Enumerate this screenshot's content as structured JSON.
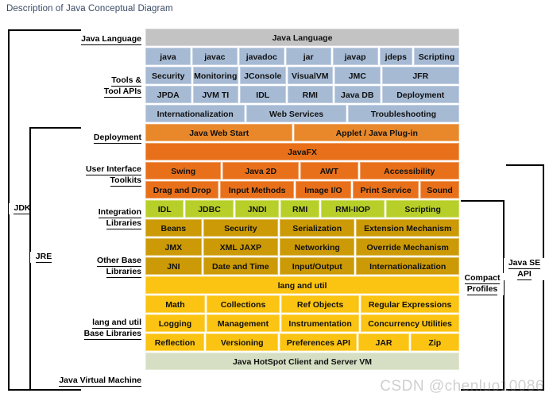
{
  "page": {
    "title": "Description of Java Conceptual Diagram",
    "watermark": "CSDN @chenluo10086"
  },
  "left_labels": {
    "java_language": "Java Language",
    "tools_line1": "Tools &",
    "tools_line2": "Tool APIs",
    "deployment": "Deployment",
    "ui_line1": "User Interface",
    "ui_line2": "Toolkits",
    "integration_line1": "Integration",
    "integration_line2": "Libraries",
    "other_base_line1": "Other Base",
    "other_base_line2": "Libraries",
    "lang_util_line1": "lang and util",
    "lang_util_line2": "Base Libraries",
    "jvm": "Java Virtual Machine"
  },
  "brackets": {
    "jdk": "JDK",
    "jre": "JRE",
    "compact_line1": "Compact",
    "compact_line2": "Profiles",
    "javase_line1": "Java SE",
    "javase_line2": "API"
  },
  "colors": {
    "gray": "#c3c3c3",
    "blue": "#a6bad4",
    "orange": "#e8882b",
    "orange_dark": "#e8701a",
    "green": "#b7cf28",
    "amber_dark": "#cc9a06",
    "amber": "#fbc312",
    "sage": "#d6dfc3"
  },
  "rows": [
    {
      "name": "java-language",
      "theme": "c-gray",
      "cells": [
        {
          "label": "Java Language",
          "flex": 1
        }
      ]
    },
    {
      "name": "tools-row-1",
      "theme": "c-blue",
      "cells": [
        {
          "label": "java",
          "flex": 1
        },
        {
          "label": "javac",
          "flex": 1
        },
        {
          "label": "javadoc",
          "flex": 1
        },
        {
          "label": "jar",
          "flex": 1
        },
        {
          "label": "javap",
          "flex": 1
        },
        {
          "label": "jdeps",
          "flex": 0.72
        },
        {
          "label": "Scripting",
          "flex": 1
        }
      ]
    },
    {
      "name": "tools-row-2",
      "theme": "c-blue",
      "cells": [
        {
          "label": "Security",
          "flex": 1
        },
        {
          "label": "Monitoring",
          "flex": 1
        },
        {
          "label": "JConsole",
          "flex": 1
        },
        {
          "label": "VisualVM",
          "flex": 1
        },
        {
          "label": "JMC",
          "flex": 1
        },
        {
          "label": "JFR",
          "flex": 1.72
        }
      ]
    },
    {
      "name": "tools-row-3",
      "theme": "c-blue",
      "cells": [
        {
          "label": "JPDA",
          "flex": 1
        },
        {
          "label": "JVM TI",
          "flex": 1
        },
        {
          "label": "IDL",
          "flex": 1
        },
        {
          "label": "RMI",
          "flex": 1
        },
        {
          "label": "Java DB",
          "flex": 1
        },
        {
          "label": "Deployment",
          "flex": 1.72
        }
      ]
    },
    {
      "name": "tools-row-4",
      "theme": "c-blue",
      "cells": [
        {
          "label": "Internationalization",
          "flex": 1
        },
        {
          "label": "Web Services",
          "flex": 1
        },
        {
          "label": "Troubleshooting",
          "flex": 1.12
        }
      ]
    },
    {
      "name": "deployment-row",
      "theme": "c-orange",
      "cells": [
        {
          "label": "Java Web Start",
          "flex": 1
        },
        {
          "label": "Applet / Java Plug-in",
          "flex": 1.12
        }
      ]
    },
    {
      "name": "javafx-row",
      "theme": "c-orange2",
      "cells": [
        {
          "label": "JavaFX",
          "flex": 1
        }
      ]
    },
    {
      "name": "ui-toolkits-row-1",
      "theme": "c-orange2",
      "cells": [
        {
          "label": "Swing",
          "flex": 1.06
        },
        {
          "label": "Java 2D",
          "flex": 1.06
        },
        {
          "label": "AWT",
          "flex": 0.8
        },
        {
          "label": "Accessibility",
          "flex": 1.4
        }
      ]
    },
    {
      "name": "ui-toolkits-row-2",
      "theme": "c-orange2",
      "cells": [
        {
          "label": "Drag and Drop",
          "flex": 1.06
        },
        {
          "label": "Input Methods",
          "flex": 1.06
        },
        {
          "label": "Image I/O",
          "flex": 0.8
        },
        {
          "label": "Print Service",
          "flex": 0.95
        },
        {
          "label": "Sound",
          "flex": 0.55
        }
      ]
    },
    {
      "name": "integration-row",
      "theme": "c-green",
      "cells": [
        {
          "label": "IDL",
          "flex": 0.62
        },
        {
          "label": "JDBC",
          "flex": 0.78
        },
        {
          "label": "JNDI",
          "flex": 0.72
        },
        {
          "label": "RMI",
          "flex": 0.62
        },
        {
          "label": "RMI-IIOP",
          "flex": 1.05
        },
        {
          "label": "Scripting",
          "flex": 1.2
        }
      ]
    },
    {
      "name": "other-base-row-1",
      "theme": "c-dkamber",
      "cells": [
        {
          "label": "Beans",
          "flex": 0.78
        },
        {
          "label": "Security",
          "flex": 1.05
        },
        {
          "label": "Serialization",
          "flex": 1.05
        },
        {
          "label": "Extension Mechanism",
          "flex": 1.45
        }
      ]
    },
    {
      "name": "other-base-row-2",
      "theme": "c-dkamber",
      "cells": [
        {
          "label": "JMX",
          "flex": 0.78
        },
        {
          "label": "XML JAXP",
          "flex": 1.05
        },
        {
          "label": "Networking",
          "flex": 1.05
        },
        {
          "label": "Override Mechanism",
          "flex": 1.45
        }
      ]
    },
    {
      "name": "other-base-row-3",
      "theme": "c-dkamber",
      "cells": [
        {
          "label": "JNI",
          "flex": 0.78
        },
        {
          "label": "Date and Time",
          "flex": 1.05
        },
        {
          "label": "Input/Output",
          "flex": 1.05
        },
        {
          "label": "Internationalization",
          "flex": 1.45
        }
      ]
    },
    {
      "name": "lang-util-row",
      "theme": "c-amber",
      "cells": [
        {
          "label": "lang and util",
          "flex": 1
        }
      ]
    },
    {
      "name": "lang-util-base-row-1",
      "theme": "c-amber",
      "cells": [
        {
          "label": "Math",
          "flex": 0.85
        },
        {
          "label": "Collections",
          "flex": 1.05
        },
        {
          "label": "Ref Objects",
          "flex": 1.12
        },
        {
          "label": "Regular Expressions",
          "flex": 1.42
        }
      ]
    },
    {
      "name": "lang-util-base-row-2",
      "theme": "c-amber",
      "cells": [
        {
          "label": "Logging",
          "flex": 0.85
        },
        {
          "label": "Management",
          "flex": 1.05
        },
        {
          "label": "Instrumentation",
          "flex": 1.12
        },
        {
          "label": "Concurrency Utilities",
          "flex": 1.42
        }
      ]
    },
    {
      "name": "lang-util-base-row-3",
      "theme": "c-amber",
      "cells": [
        {
          "label": "Reflection",
          "flex": 0.85
        },
        {
          "label": "Versioning",
          "flex": 1.05
        },
        {
          "label": "Preferences API",
          "flex": 1.12
        },
        {
          "label": "JAR",
          "flex": 0.72
        },
        {
          "label": "Zip",
          "flex": 0.7
        }
      ]
    },
    {
      "name": "jvm-row",
      "theme": "c-sage",
      "cells": [
        {
          "label": "Java HotSpot Client and Server VM",
          "flex": 1
        }
      ]
    }
  ]
}
